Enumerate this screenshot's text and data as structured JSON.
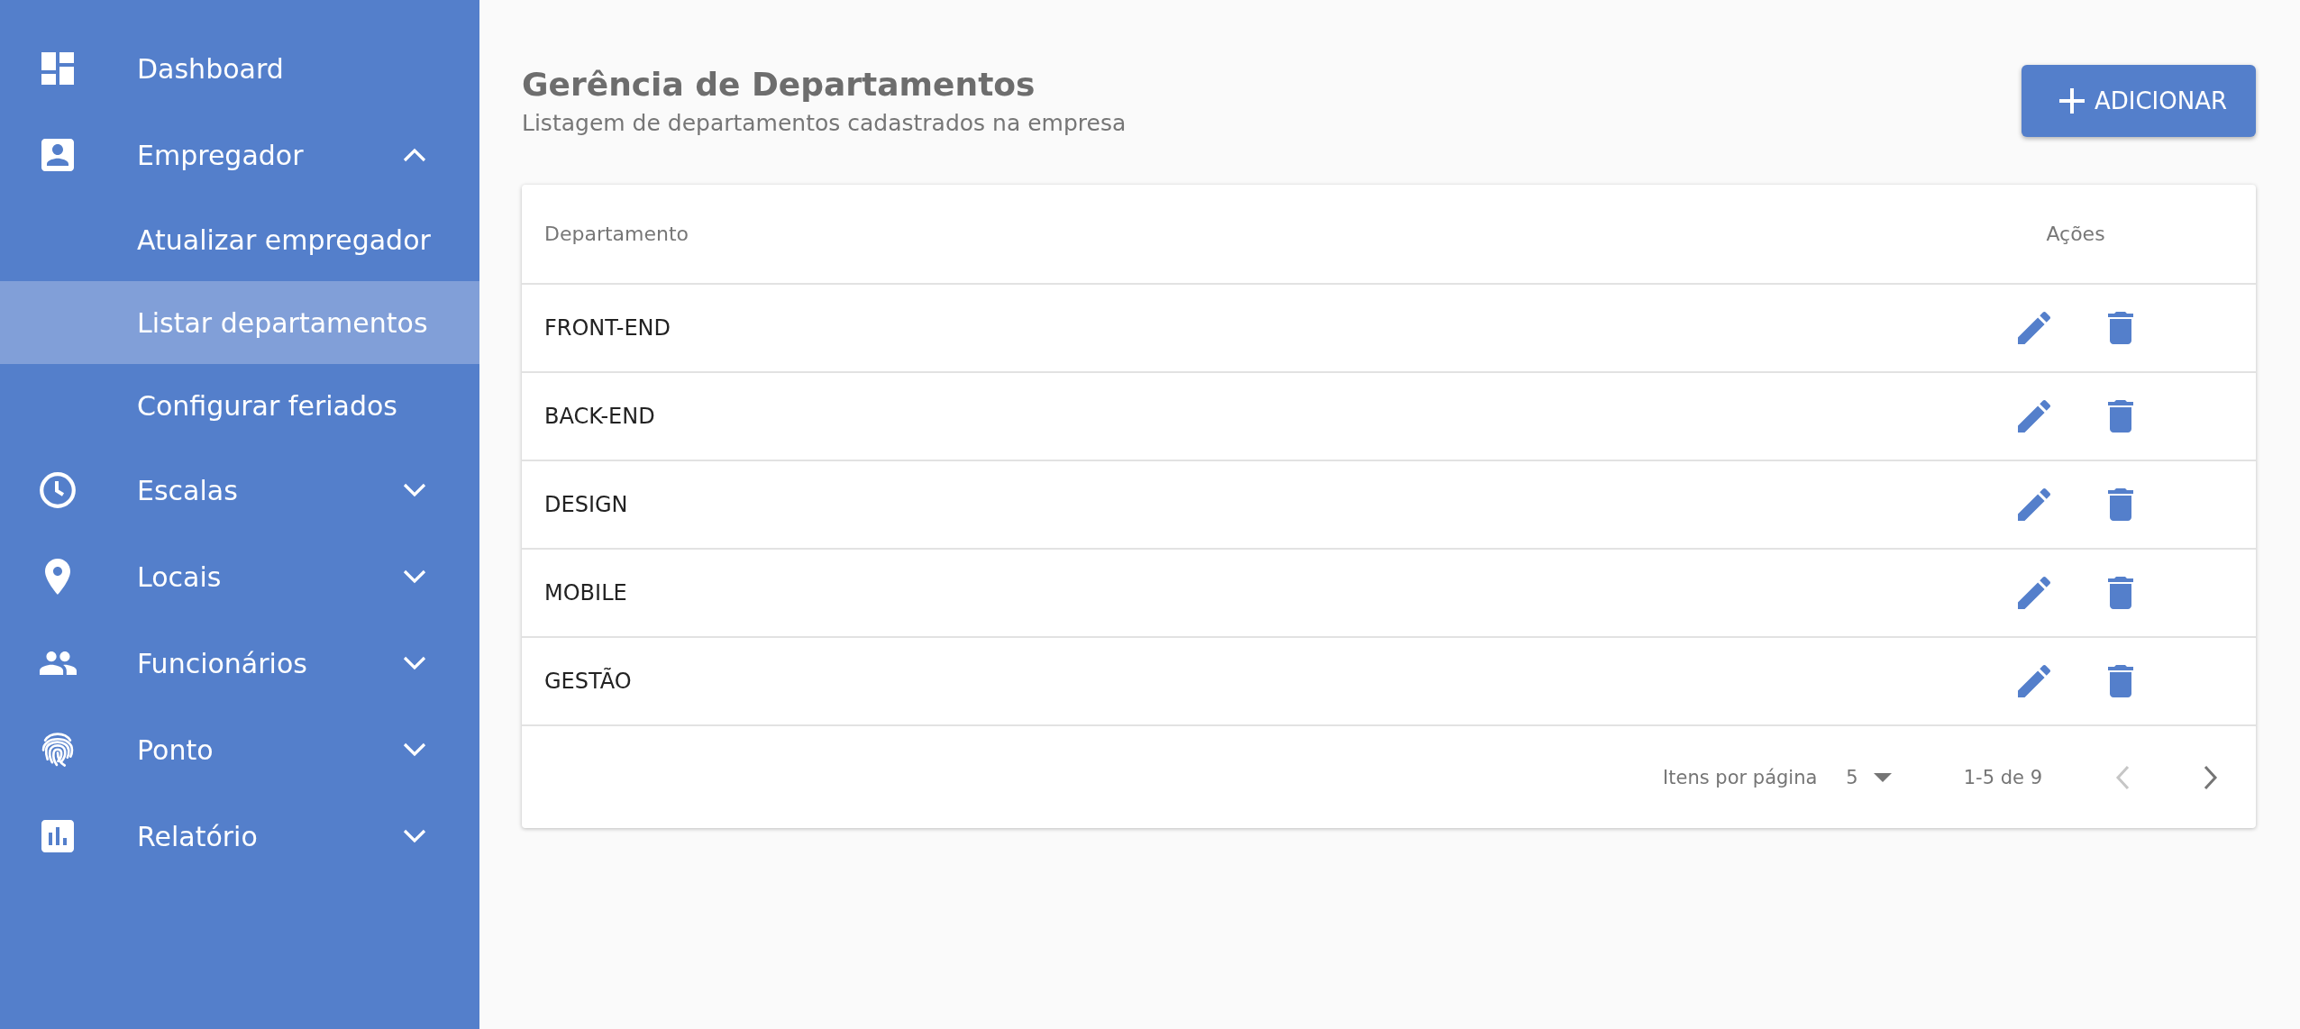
{
  "sidebar": {
    "items": [
      {
        "kind": "link",
        "label": "Dashboard",
        "selected": false
      },
      {
        "kind": "group",
        "label": "Empregador",
        "selected": false,
        "expanded": true,
        "children": [
          {
            "label": "Atualizar empregador",
            "selected": false
          },
          {
            "label": "Listar departamentos",
            "selected": true
          },
          {
            "label": "Configurar feriados",
            "selected": false
          }
        ]
      },
      {
        "kind": "group",
        "label": "Escalas",
        "selected": false,
        "expanded": false
      },
      {
        "kind": "group",
        "label": "Locais",
        "selected": false,
        "expanded": false
      },
      {
        "kind": "group",
        "label": "Funcionários",
        "selected": false,
        "expanded": false
      },
      {
        "kind": "group",
        "label": "Ponto",
        "selected": false,
        "expanded": false
      },
      {
        "kind": "group",
        "label": "Relatório",
        "selected": false,
        "expanded": false
      }
    ]
  },
  "header": {
    "title": "Gerência de Departamentos",
    "subtitle": "Listagem de departamentos cadastrados na empresa",
    "add_button": "ADICIONAR"
  },
  "table": {
    "columns": [
      "Departamento",
      "Ações"
    ],
    "rows": [
      {
        "department": "FRONT-END"
      },
      {
        "department": "BACK-END"
      },
      {
        "department": "DESIGN"
      },
      {
        "department": "MOBILE"
      },
      {
        "department": "GESTÃO"
      }
    ]
  },
  "pagination": {
    "label": "Itens por página",
    "page_size": "5",
    "range": "1-5 de 9",
    "previous": {
      "disabled": true
    },
    "next": {
      "disabled": false
    }
  }
}
